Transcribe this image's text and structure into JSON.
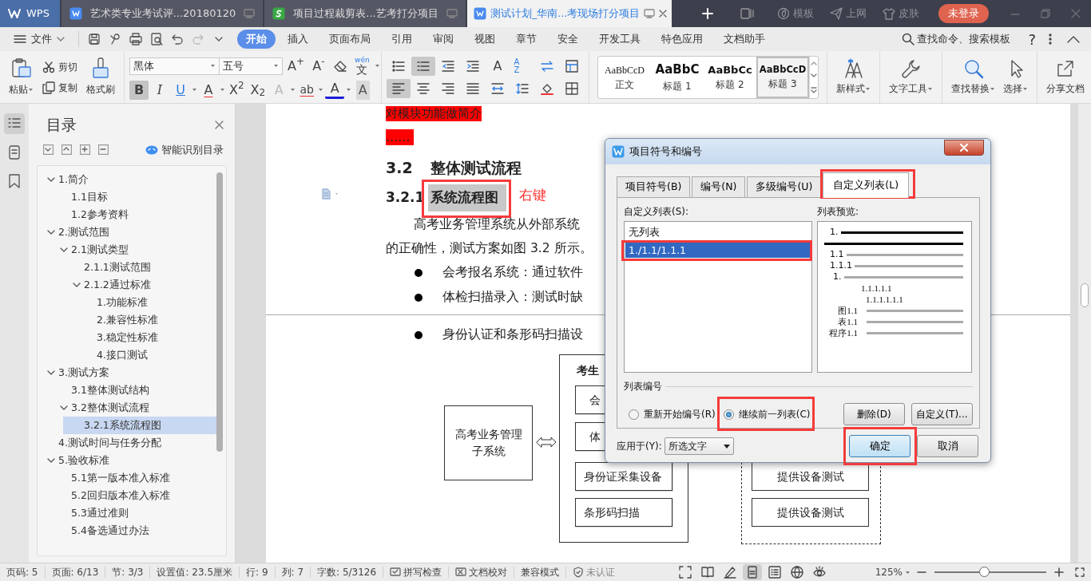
{
  "app_tabs": [
    {
      "kind": "home",
      "label": "WPS",
      "selected": false
    },
    {
      "kind": "writer",
      "label": "艺术类专业考试评...20180120",
      "selected": false
    },
    {
      "kind": "sheet",
      "label": "项目过程裁剪表...艺考打分项目",
      "selected": false
    },
    {
      "kind": "writer",
      "label": "测试计划_华南...考现场打分项目",
      "selected": true
    }
  ],
  "title_actions": [
    {
      "kind": "template",
      "label": "模板"
    },
    {
      "kind": "web",
      "label": "上网"
    },
    {
      "kind": "skin",
      "label": "皮肤"
    }
  ],
  "login": "未登录",
  "menu_file": "文件",
  "menu_tabs": [
    {
      "label": "开始",
      "selected": true
    },
    {
      "label": "插入",
      "selected": false
    },
    {
      "label": "页面布局",
      "selected": false
    },
    {
      "label": "引用",
      "selected": false
    },
    {
      "label": "审阅",
      "selected": false
    },
    {
      "label": "视图",
      "selected": false
    },
    {
      "label": "章节",
      "selected": false
    },
    {
      "label": "安全",
      "selected": false
    },
    {
      "label": "开发工具",
      "selected": false
    },
    {
      "label": "特色应用",
      "selected": false
    },
    {
      "label": "文档助手",
      "selected": false
    }
  ],
  "command_search": "查找命令、搜索模板",
  "help": "?",
  "clipboard": {
    "paste": "粘贴",
    "cut": "剪切",
    "copy": "复制",
    "painter": "格式刷"
  },
  "font_name": "黑体",
  "font_size": "五号",
  "font_tools_top": [
    {
      "kind": "grow",
      "label": "A$^{+}$"
    },
    {
      "kind": "shrink",
      "label": "A$^{-}$"
    },
    {
      "kind": "clear"
    },
    {
      "kind": "pinyin",
      "label": "wén",
      "base": "文"
    }
  ],
  "font_tools": [
    {
      "kind": "bold",
      "label": "B",
      "selected": true
    },
    {
      "kind": "italic",
      "label": "I",
      "selected": false
    },
    {
      "kind": "underline",
      "label": "U",
      "selected": false
    },
    {
      "kind": "strike",
      "label": "A",
      "selected": false
    },
    {
      "kind": "sup",
      "label": "X$^{2}$",
      "selected": false
    },
    {
      "kind": "sub",
      "label": "X$_{2}$",
      "selected": false
    },
    {
      "kind": "outline",
      "label": "A",
      "selected": false
    },
    {
      "kind": "highlight",
      "label": "ab",
      "selected": false
    },
    {
      "kind": "color",
      "label": "A",
      "selected": false
    },
    {
      "kind": "shade",
      "label": "A",
      "selected": false
    }
  ],
  "para_tools": [
    {
      "kind": "bullets",
      "selected": false
    },
    {
      "kind": "numbering",
      "selected": true
    },
    {
      "kind": "outdent",
      "selected": false
    },
    {
      "kind": "indent",
      "selected": false
    },
    {
      "kind": "char_scale",
      "label": "A",
      "selected": false
    },
    {
      "kind": "sort",
      "label": "AZ",
      "selected": false
    },
    {
      "kind": "swap",
      "selected": false
    },
    {
      "kind": "table",
      "selected": false
    },
    {
      "kind": "align_left",
      "selected": true
    },
    {
      "kind": "align_center",
      "selected": false
    },
    {
      "kind": "align_right",
      "selected": false
    },
    {
      "kind": "justify",
      "selected": false
    },
    {
      "kind": "distribute",
      "selected": false
    },
    {
      "kind": "line_spacing",
      "selected": false
    },
    {
      "kind": "fill",
      "selected": false
    },
    {
      "kind": "borders",
      "selected": false
    }
  ],
  "styles": [
    {
      "sample": "AaBbCcD",
      "label": "正文",
      "selected": false
    },
    {
      "sample": "AaBbC",
      "label": "标题 1",
      "selected": false
    },
    {
      "sample": "AaBbCc",
      "label": "标题 2",
      "selected": false
    },
    {
      "sample": "AaBbCcD",
      "label": "标题 3",
      "selected": true
    }
  ],
  "new_style": "新样式",
  "text_tools": "文字工具",
  "find_replace": "查找替换",
  "select": "选择",
  "share": "分享文档",
  "rail": [
    {
      "kind": "toc",
      "selected": true
    },
    {
      "kind": "pages",
      "selected": false
    },
    {
      "kind": "bookmark",
      "selected": false
    }
  ],
  "toc": {
    "title": "目录",
    "smart": "智能识别目录",
    "items": [
      {
        "label": "1.简介",
        "expanded": true,
        "selected": false,
        "children": [
          {
            "label": "1.1目标",
            "selected": false
          },
          {
            "label": "1.2参考资料",
            "selected": false
          }
        ]
      },
      {
        "label": "2.测试范围",
        "expanded": true,
        "selected": false,
        "children": [
          {
            "label": "2.1测试类型",
            "expanded": true,
            "selected": false,
            "children": [
              {
                "label": "2.1.1测试范围",
                "selected": false
              },
              {
                "label": "2.1.2通过标准",
                "expanded": true,
                "selected": false,
                "children": [
                  {
                    "label": "1.功能标准",
                    "selected": false
                  },
                  {
                    "label": "2.兼容性标准",
                    "selected": false
                  },
                  {
                    "label": "3.稳定性标准",
                    "selected": false
                  },
                  {
                    "label": "4.接口测试",
                    "selected": false
                  }
                ]
              }
            ]
          }
        ]
      },
      {
        "label": "3.测试方案",
        "expanded": true,
        "selected": false,
        "children": [
          {
            "label": "3.1整体测试结构",
            "selected": false
          },
          {
            "label": "3.2整体测试流程",
            "expanded": true,
            "selected": false,
            "children": [
              {
                "label": "3.2.1系统流程图",
                "selected": true
              }
            ]
          }
        ]
      },
      {
        "label": "4.测试时间与任务分配",
        "selected": false
      },
      {
        "label": "5.验收标准",
        "expanded": true,
        "selected": false,
        "children": [
          {
            "label": "5.1第一版本准入标准",
            "selected": false
          },
          {
            "label": "5.2回归版本准入标准",
            "selected": false
          },
          {
            "label": "5.3通过准则",
            "selected": false
          },
          {
            "label": "5.4备选通过办法",
            "selected": false
          }
        ]
      }
    ]
  },
  "document": {
    "highlighted": "对模块功能做简介",
    "ellipsis": "......",
    "heading2": {
      "number": "3.2",
      "text": "整体测试流程"
    },
    "heading3": {
      "number": "3.2.1",
      "text": "系统流程图",
      "selected": true,
      "annotated": true
    },
    "annotation": "右键",
    "paragraph": [
      "高考业务管理系统从外部系统",
      "的正确性，测试方案如图  3.2 所示。"
    ],
    "bullets": [
      "会考报名系统：通过软件",
      "体检扫描录入：测试时缺",
      "身份认证和条形码扫描设"
    ],
    "diagram": {
      "system": "高考业务管理子系统",
      "group_title": "考生",
      "group_items": [
        "会",
        "体",
        "身份证采集设备",
        "条形码扫描"
      ],
      "device_items": [
        "提供设备测试",
        "提供设备测试"
      ]
    }
  },
  "dialog": {
    "title": "项目符号和编号",
    "tabs": [
      {
        "label": "项目符号(B)",
        "selected": false,
        "annotated": false
      },
      {
        "label": "编号(N)",
        "selected": false,
        "annotated": false
      },
      {
        "label": "多级编号(U)",
        "selected": false,
        "annotated": false
      },
      {
        "label": "自定义列表(L)",
        "selected": true,
        "annotated": true
      }
    ],
    "list_label": "自定义列表(S):",
    "list_items": [
      {
        "label": "无列表",
        "selected": false,
        "annotated": false
      },
      {
        "label": "1./1.1/1.1.1",
        "selected": true,
        "annotated": true
      }
    ],
    "preview_label": "列表预览:",
    "preview_lines": [
      {
        "kind": "bold",
        "label": "1."
      },
      {
        "kind": "bold_full"
      },
      {
        "kind": "rule",
        "label": "1.1"
      },
      {
        "kind": "rule",
        "label": "1.1.1"
      },
      {
        "kind": "rule_indent",
        "label": "1."
      },
      {
        "kind": "deep",
        "label": "1.1.1.1.1"
      },
      {
        "kind": "deeper",
        "label": "1.1.1.1.1.1"
      },
      {
        "kind": "caption",
        "label": "图1.1"
      },
      {
        "kind": "caption",
        "label": "表1.1"
      },
      {
        "kind": "caption",
        "label": "程序1.1"
      }
    ],
    "group_label": "列表编号",
    "radios": [
      {
        "label": "重新开始编号(R)",
        "checked": false,
        "annotated": false
      },
      {
        "label": "继续前一列表(C)",
        "checked": true,
        "annotated": true
      }
    ],
    "buttons": [
      "删除(D)",
      "自定义(T)..."
    ],
    "apply_label": "应用于(Y):",
    "apply_value": "所选文字",
    "footer_buttons": [
      {
        "label": "确定",
        "kind": "default",
        "annotated": true
      },
      {
        "label": "取消",
        "kind": "normal",
        "annotated": false
      }
    ]
  },
  "status": {
    "items": [
      {
        "kind": "text",
        "text": "页码: 5"
      },
      {
        "kind": "text",
        "text": "页面: 6/13"
      },
      {
        "kind": "text",
        "text": "节: 3/3"
      },
      {
        "kind": "text",
        "text": "设置值: 23.5厘米"
      },
      {
        "kind": "text",
        "text": "行: 9"
      },
      {
        "kind": "text",
        "text": "列: 7"
      },
      {
        "kind": "text",
        "text": "字数: 5/3126"
      },
      {
        "kind": "spell",
        "text": "拼写检查"
      },
      {
        "kind": "proof",
        "text": "文档校对"
      },
      {
        "kind": "text",
        "text": "兼容模式"
      },
      {
        "kind": "cert",
        "text": "未认证"
      }
    ],
    "views": [
      {
        "kind": "focus",
        "selected": false
      },
      {
        "kind": "read",
        "selected": false
      },
      {
        "kind": "write",
        "selected": false
      },
      {
        "kind": "page",
        "selected": true
      },
      {
        "kind": "outline",
        "selected": false
      },
      {
        "kind": "web",
        "selected": false
      },
      {
        "kind": "eye",
        "selected": false
      }
    ],
    "zoom": "125%",
    "zoom_slider": {
      "level": 0.44
    }
  }
}
